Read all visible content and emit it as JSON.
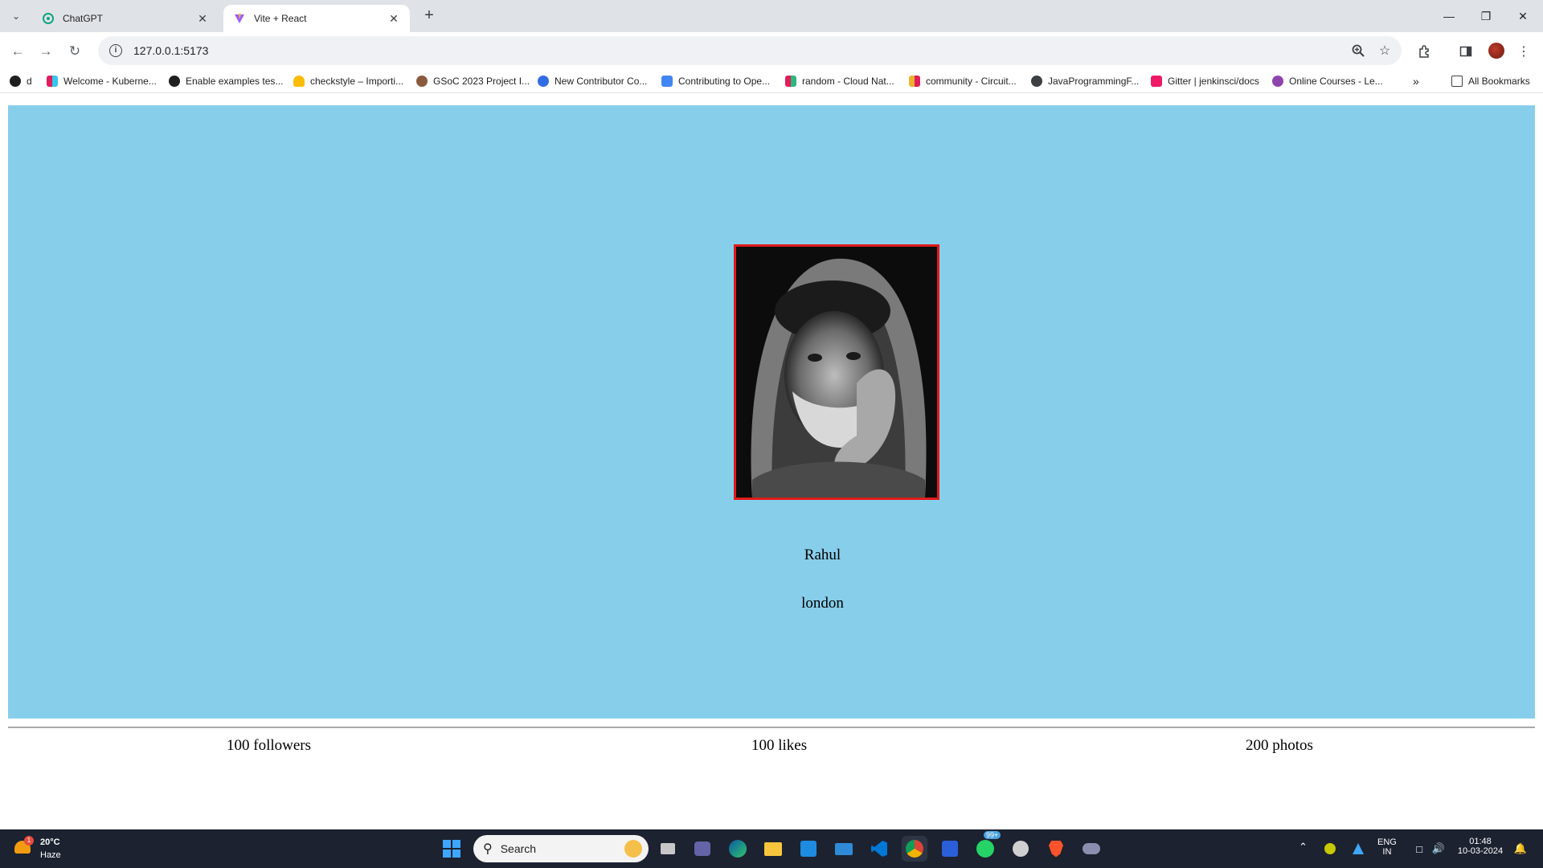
{
  "browser": {
    "tabs": [
      {
        "title": "ChatGPT",
        "active": false
      },
      {
        "title": "Vite + React",
        "active": true
      }
    ],
    "url": "127.0.0.1:5173",
    "bookmarks": [
      "d",
      "Welcome - Kuberne...",
      "Enable examples tes...",
      "checkstyle – Importi...",
      "GSoC 2023 Project I...",
      "New Contributor Co...",
      "Contributing to Ope...",
      "random - Cloud Nat...",
      "community - Circuit...",
      "JavaProgrammingF...",
      "Gitter | jenkinsci/docs",
      "Online Courses - Le..."
    ],
    "all_bookmarks_label": "All Bookmarks"
  },
  "profile_card": {
    "name": "Rahul",
    "city": "london"
  },
  "stats": {
    "followers": "100 followers",
    "likes": "100 likes",
    "photos": "200 photos"
  },
  "taskbar": {
    "weather_temp": "20°C",
    "weather_desc": "Haze",
    "weather_badge": "1",
    "search_placeholder": "Search",
    "whatsapp_badge": "99+",
    "lang_top": "ENG",
    "lang_bottom": "IN",
    "time": "01:48",
    "date": "10-03-2024"
  },
  "colors": {
    "card_bg": "#87ceeb",
    "photo_border": "#e01a1a",
    "taskbar_bg": "#1c2230"
  }
}
